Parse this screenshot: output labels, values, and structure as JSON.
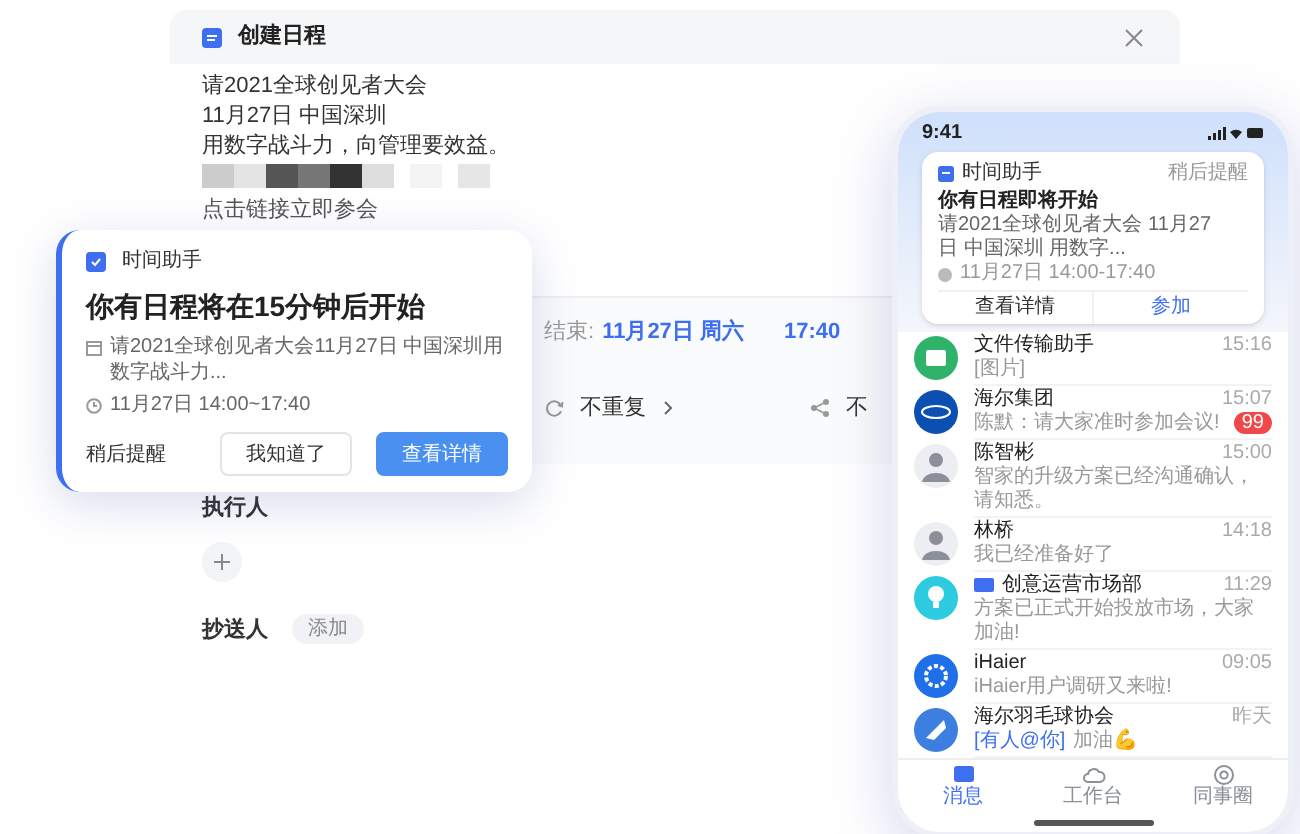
{
  "dialog": {
    "title": "创建日程",
    "lines": [
      "请2021全球创见者大会",
      "11月27日 中国深圳",
      "用数字战斗力，向管理要效益。"
    ],
    "link": "点击链接立即参会",
    "end_label": "结束:",
    "end_date": "11月27日 周六",
    "end_time": "17:40",
    "repeat": "不重复",
    "share": "不",
    "assignee_label": "执行人",
    "cc_label": "抄送人",
    "cc_add": "添加"
  },
  "reminder_card": {
    "app": "时间助手",
    "title": "你有日程将在15分钟后开始",
    "event": "请2021全球创见者大会11月27日 中国深圳用数字战斗力...",
    "time": "11月27日 14:00~17:40",
    "snooze": "稍后提醒",
    "buttons": [
      {
        "label": "我知道了",
        "kind": "secondary"
      },
      {
        "label": "查看详情",
        "kind": "primary"
      }
    ]
  },
  "phone": {
    "time": "9:41",
    "notification": {
      "app": "时间助手",
      "snooze": "稍后提醒",
      "title": "你有日程即将开始",
      "event": "请2021全球创见者大会 11月27日 中国深圳 用数字...",
      "time": "11月27日 14:00-17:40",
      "actions": [
        "查看详情",
        "参加"
      ]
    },
    "chats": [
      {
        "name": "文件传输助手",
        "preview": "[图片]",
        "time": "15:16",
        "kind": "folder",
        "color": "#2fb36b"
      },
      {
        "name": "海尔集团",
        "preview": "陈默：请大家准时参加会议!",
        "time": "15:07",
        "kind": "logo",
        "color": "#0b4fb3",
        "badge": "99"
      },
      {
        "name": "陈智彬",
        "preview": "智家的升级方案已经沟通确认，请知悉。",
        "time": "15:00",
        "kind": "person",
        "color": "#eceef2"
      },
      {
        "name": "林桥",
        "preview": "我已经准备好了",
        "time": "14:18",
        "kind": "person",
        "color": "#eceef2"
      },
      {
        "name": "创意运营市场部",
        "preview": "方案已正式开始投放市场，大家加油!",
        "time": "11:29",
        "kind": "bulb",
        "color": "#2ccbe0",
        "tag": true
      },
      {
        "name": "iHaier",
        "preview": "iHaier用户调研又来啦!",
        "time": "09:05",
        "kind": "gear",
        "color": "#1f6fe8"
      },
      {
        "name": "海尔羽毛球协会",
        "mention": "[有人@你]",
        "preview": "加油💪",
        "time": "昨天",
        "kind": "shuttle",
        "color": "#3d7fe0"
      }
    ],
    "tabs": [
      {
        "label": "消息",
        "selected": true
      },
      {
        "label": "工作台",
        "selected": false
      },
      {
        "label": "同事圈",
        "selected": false
      }
    ]
  }
}
